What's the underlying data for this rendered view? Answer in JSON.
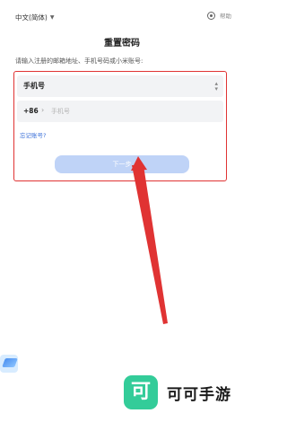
{
  "header": {
    "language": "中文(简体)",
    "help_label": "帮助"
  },
  "page": {
    "title": "重置密码",
    "hint": "请输入注册的邮箱地址、手机号码或小米账号:"
  },
  "form": {
    "account_type": "手机号",
    "country_code": "+86",
    "phone_placeholder": "手机号",
    "forgot_link": "忘记账号?",
    "next_button": "下一步"
  },
  "watermark": {
    "logo_char": "可",
    "name": "可可手游"
  },
  "colors": {
    "highlight_red": "#e03333",
    "button_disabled": "#bfd3f7",
    "link_blue": "#3a6fd8",
    "watermark_green": "#33cc99"
  }
}
